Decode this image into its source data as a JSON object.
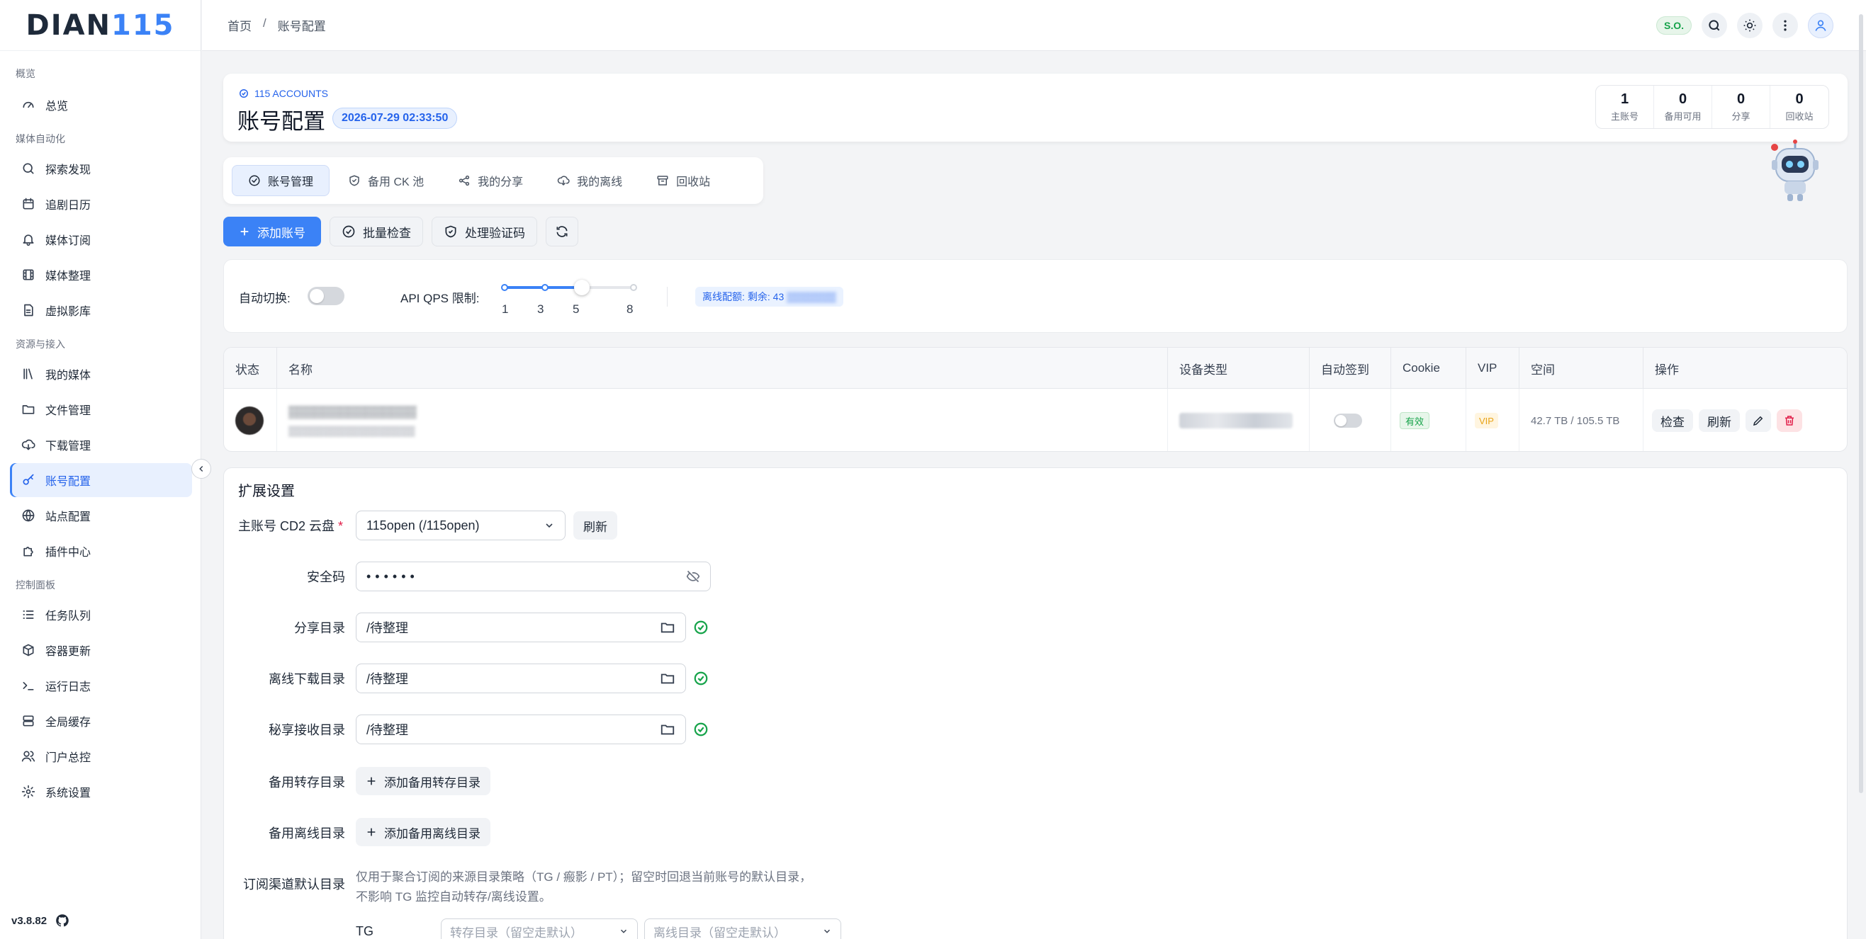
{
  "logo": {
    "part1": "DIAN",
    "part2": "115"
  },
  "version": "v3.8.82",
  "breadcrumb": {
    "home": "首页",
    "sep": "/",
    "current": "账号配置"
  },
  "top": {
    "badge": "S.O."
  },
  "sidebar": {
    "groups": [
      {
        "title": "概览",
        "items": [
          {
            "label": "总览",
            "icon": "gauge-icon"
          }
        ]
      },
      {
        "title": "媒体自动化",
        "items": [
          {
            "label": "探索发现",
            "icon": "search-icon"
          },
          {
            "label": "追剧日历",
            "icon": "calendar-icon"
          },
          {
            "label": "媒体订阅",
            "icon": "bell-icon"
          },
          {
            "label": "媒体整理",
            "icon": "film-icon"
          },
          {
            "label": "虚拟影库",
            "icon": "file-icon"
          }
        ]
      },
      {
        "title": "资源与接入",
        "items": [
          {
            "label": "我的媒体",
            "icon": "library-icon"
          },
          {
            "label": "文件管理",
            "icon": "folder-icon"
          },
          {
            "label": "下载管理",
            "icon": "cloud-download-icon"
          },
          {
            "label": "账号配置",
            "icon": "key-icon",
            "active": true
          },
          {
            "label": "站点配置",
            "icon": "globe-icon"
          },
          {
            "label": "插件中心",
            "icon": "puzzle-icon"
          }
        ]
      },
      {
        "title": "控制面板",
        "items": [
          {
            "label": "任务队列",
            "icon": "list-icon"
          },
          {
            "label": "容器更新",
            "icon": "package-icon"
          },
          {
            "label": "运行日志",
            "icon": "terminal-icon"
          },
          {
            "label": "全局缓存",
            "icon": "server-icon"
          },
          {
            "label": "门户总控",
            "icon": "users-icon"
          },
          {
            "label": "系统设置",
            "icon": "gear-icon"
          }
        ]
      }
    ]
  },
  "header": {
    "subtitle": "115 ACCOUNTS",
    "title": "账号配置",
    "date": "2026-07-29 02:33:50",
    "stats": [
      {
        "value": "1",
        "label": "主账号"
      },
      {
        "value": "0",
        "label": "备用可用"
      },
      {
        "value": "0",
        "label": "分享"
      },
      {
        "value": "0",
        "label": "回收站"
      }
    ]
  },
  "tabs": [
    {
      "label": "账号管理",
      "icon": "check-circle-icon",
      "active": true
    },
    {
      "label": "备用 CK 池",
      "icon": "shield-icon"
    },
    {
      "label": "我的分享",
      "icon": "share-icon"
    },
    {
      "label": "我的离线",
      "icon": "cloud-download-icon"
    },
    {
      "label": "回收站",
      "icon": "archive-icon"
    }
  ],
  "toolbar": {
    "add": "添加账号",
    "batch_check": "批量检查",
    "captcha": "处理验证码"
  },
  "options": {
    "auto_switch_label": "自动切换:",
    "auto_switch_on": false,
    "qps_label": "API QPS 限制:",
    "qps_ticks": [
      "1",
      "3",
      "5",
      "8"
    ],
    "qps_value": 5,
    "quota_label": "离线配额:",
    "quota_value": "剩余: 43"
  },
  "table": {
    "headers": [
      "状态",
      "名称",
      "设备类型",
      "自动签到",
      "Cookie",
      "VIP",
      "空间",
      "操作"
    ],
    "rows": [
      {
        "cookie": "有效",
        "vip": "VIP",
        "space": "42.7 TB / 105.5 TB",
        "auto_sign": false,
        "actions": {
          "check": "检查",
          "refresh": "刷新"
        }
      }
    ]
  },
  "extended": {
    "title": "扩展设置",
    "cd2_label": "主账号 CD2 云盘",
    "cd2_value": "115open (/115open)",
    "refresh": "刷新",
    "security_label": "安全码",
    "security_value": "••••••",
    "share_dir_label": "分享目录",
    "share_dir_value": "/待整理",
    "offline_dir_label": "离线下载目录",
    "offline_dir_value": "/待整理",
    "secret_dir_label": "秘享接收目录",
    "secret_dir_value": "/待整理",
    "backup_transfer_label": "备用转存目录",
    "backup_transfer_btn": "添加备用转存目录",
    "backup_offline_label": "备用离线目录",
    "backup_offline_btn": "添加备用离线目录",
    "sub_default_label": "订阅渠道默认目录",
    "sub_hint_1": "仅用于聚合订阅的来源目录策略（TG / 瘢影 / PT）；留空时回退当前账号的默认目录，",
    "sub_hint_2": "不影响 TG 监控自动转存/离线设置。",
    "tg_label": "TG",
    "tg_transfer_placeholder": "转存目录（留空走默认）",
    "tg_offline_placeholder": "离线目录（留空走默认）"
  }
}
